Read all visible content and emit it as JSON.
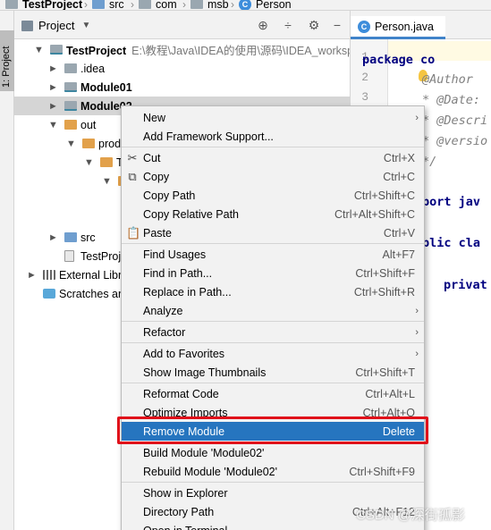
{
  "breadcrumb": [
    "TestProject",
    "src",
    "com",
    "msb",
    "Person"
  ],
  "stripe": {
    "tab_label": "1: Project"
  },
  "panel": {
    "title": "Project",
    "dropdown_glyph": "▼",
    "buttons": [
      "⊕",
      "÷",
      "⚙",
      "−"
    ]
  },
  "tree": [
    {
      "label": "TestProject",
      "path": "E:\\教程\\Java\\IDEA的使用\\源码\\IDEA_workspace",
      "bold": true,
      "arrow": "▼",
      "icon": "module"
    },
    {
      "label": ".idea",
      "bold": false,
      "arrow": "►",
      "icon": "gray"
    },
    {
      "label": "Module01",
      "bold": true,
      "arrow": "►",
      "icon": "module"
    },
    {
      "label": "Module02",
      "bold": true,
      "arrow": "►",
      "icon": "module",
      "selected": true
    },
    {
      "label": "out",
      "bold": false,
      "arrow": "▼",
      "icon": "orange"
    },
    {
      "label": "produc",
      "bold": false,
      "arrow": "▼",
      "icon": "orange"
    },
    {
      "label": "Tes",
      "bold": false,
      "arrow": "▼",
      "icon": "orange"
    },
    {
      "label": "",
      "bold": false,
      "arrow": "▼",
      "icon": "orange"
    },
    {
      "label": "",
      "bold": false,
      "arrow": "►",
      "icon": "none"
    },
    {
      "label": "",
      "bold": false,
      "arrow": "",
      "icon": "none"
    },
    {
      "label": "src",
      "bold": false,
      "arrow": "►",
      "icon": "blue"
    },
    {
      "label": "TestProjec",
      "bold": false,
      "arrow": "",
      "icon": "file"
    },
    {
      "label": "External Libra",
      "bold": false,
      "arrow": "►",
      "icon": "bars"
    },
    {
      "label": "Scratches and",
      "bold": false,
      "arrow": "",
      "icon": "scratch"
    }
  ],
  "editor": {
    "tab_label": "Person.java",
    "class_icon_letter": "C",
    "line_numbers": [
      "1",
      "2",
      "3"
    ],
    "code": [
      {
        "text": "package co",
        "kind": "kw"
      },
      {
        "text": "@Author",
        "kind": "cm"
      },
      {
        "text": "* @Date: ",
        "kind": "cm"
      },
      {
        "text": "* @Descri",
        "kind": "cm"
      },
      {
        "text": "* @versio",
        "kind": "cm"
      },
      {
        "text": "*/",
        "kind": "cm"
      },
      {
        "text": "port jav",
        "kind": "kw"
      },
      {
        "text": "blic cla",
        "kind": "kw"
      },
      {
        "text": "privat",
        "kind": "kw"
      }
    ]
  },
  "menu": {
    "items": [
      {
        "label": "New",
        "shortcut": "",
        "submenu": true,
        "icon": ""
      },
      {
        "label": "Add Framework Support...",
        "shortcut": "",
        "submenu": false,
        "icon": ""
      },
      {
        "sep": true
      },
      {
        "label": "Cut",
        "shortcut": "Ctrl+X",
        "submenu": false,
        "icon": "✂"
      },
      {
        "label": "Copy",
        "shortcut": "Ctrl+C",
        "submenu": false,
        "icon": "⧉"
      },
      {
        "label": "Copy Path",
        "shortcut": "Ctrl+Shift+C",
        "submenu": false,
        "icon": ""
      },
      {
        "label": "Copy Relative Path",
        "shortcut": "Ctrl+Alt+Shift+C",
        "submenu": false,
        "icon": ""
      },
      {
        "label": "Paste",
        "shortcut": "Ctrl+V",
        "submenu": false,
        "icon": "📋"
      },
      {
        "sep": true
      },
      {
        "label": "Find Usages",
        "shortcut": "Alt+F7",
        "submenu": false,
        "icon": ""
      },
      {
        "label": "Find in Path...",
        "shortcut": "Ctrl+Shift+F",
        "submenu": false,
        "icon": ""
      },
      {
        "label": "Replace in Path...",
        "shortcut": "Ctrl+Shift+R",
        "submenu": false,
        "icon": ""
      },
      {
        "label": "Analyze",
        "shortcut": "",
        "submenu": true,
        "icon": ""
      },
      {
        "sep": true
      },
      {
        "label": "Refactor",
        "shortcut": "",
        "submenu": true,
        "icon": ""
      },
      {
        "sep": true
      },
      {
        "label": "Add to Favorites",
        "shortcut": "",
        "submenu": true,
        "icon": ""
      },
      {
        "label": "Show Image Thumbnails",
        "shortcut": "Ctrl+Shift+T",
        "submenu": false,
        "icon": ""
      },
      {
        "sep": true
      },
      {
        "label": "Reformat Code",
        "shortcut": "Ctrl+Alt+L",
        "submenu": false,
        "icon": ""
      },
      {
        "label": "Optimize Imports",
        "shortcut": "Ctrl+Alt+O",
        "submenu": false,
        "icon": ""
      },
      {
        "label": "Remove Module",
        "shortcut": "Delete",
        "submenu": false,
        "icon": "",
        "active": true
      },
      {
        "sep": true
      },
      {
        "label": "Build Module 'Module02'",
        "shortcut": "",
        "submenu": false,
        "icon": ""
      },
      {
        "label": "Rebuild Module 'Module02'",
        "shortcut": "Ctrl+Shift+F9",
        "submenu": false,
        "icon": ""
      },
      {
        "sep": true
      },
      {
        "label": "Show in Explorer",
        "shortcut": "",
        "submenu": false,
        "icon": ""
      },
      {
        "label": "Directory Path",
        "shortcut": "Ctrl+Alt+F12",
        "submenu": false,
        "icon": ""
      },
      {
        "label": "Open in Terminal",
        "shortcut": "",
        "submenu": false,
        "icon": ""
      }
    ]
  },
  "watermark": "CSDN @深街孤影",
  "colors": {
    "accent": "#2675bf",
    "highlight_box": "#e0101a",
    "selection": "#d5d5d5"
  }
}
